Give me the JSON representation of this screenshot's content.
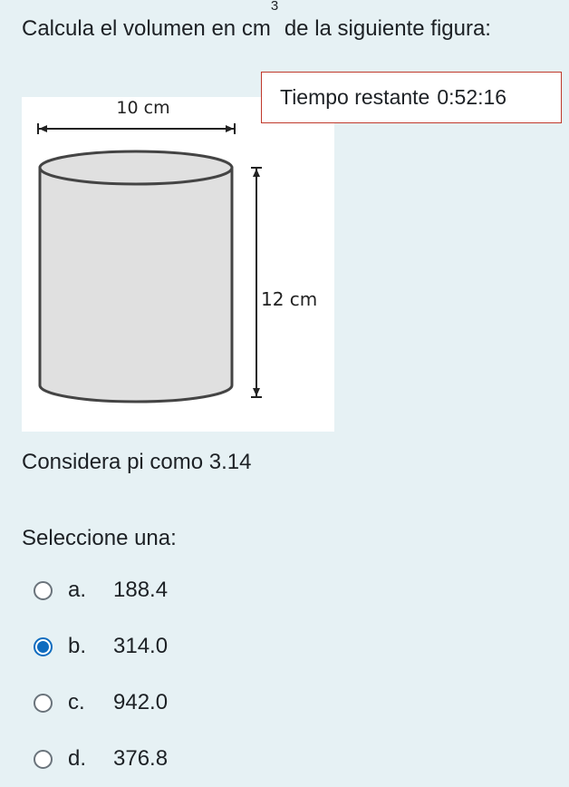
{
  "question": {
    "text_before": "Calcula el volumen en ",
    "unit_base": "cm",
    "unit_exp": "3",
    "text_after": " de la siguiente figura:"
  },
  "timer": {
    "label": "Tiempo restante",
    "value": "0:52:16"
  },
  "figure": {
    "diameter_label": "10 cm",
    "height_label": "12 cm",
    "icon": "cylinder-diagram"
  },
  "pi_note": "Considera pi como 3.14",
  "prompt": "Seleccione una:",
  "options": [
    {
      "letter": "a.",
      "value": "188.4",
      "selected": false
    },
    {
      "letter": "b.",
      "value": "314.0",
      "selected": true
    },
    {
      "letter": "c.",
      "value": "942.0",
      "selected": false
    },
    {
      "letter": "d.",
      "value": "376.8",
      "selected": false
    }
  ],
  "colors": {
    "accent": "#0f6cbf",
    "background": "#e6f1f4",
    "timer_border": "#c0392b",
    "cylinder_fill": "#e0e0e0"
  }
}
